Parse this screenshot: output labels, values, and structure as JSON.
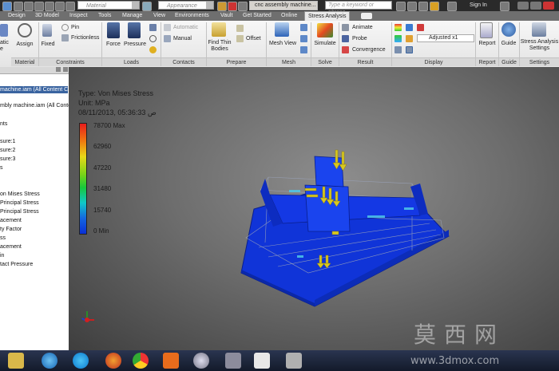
{
  "quick_access": {
    "material": "Material",
    "appearance": "Appearance",
    "doc_title": "cnc assembly machine...",
    "search_placeholder": "Type a keyword or phrase",
    "sign_in": "Sign In"
  },
  "tabs": [
    "Design",
    "3D Model",
    "Inspect",
    "Tools",
    "Manage",
    "View",
    "Environments",
    "Vault",
    "Get Started",
    "Online",
    "Stress Analysis"
  ],
  "ribbon": {
    "static_label_1": "atic",
    "static_label_2": "e",
    "assign": "Assign",
    "fixed": "Fixed",
    "pin": "Pin",
    "frictionless": "Frictionless",
    "force": "Force",
    "pressure": "Pressure",
    "automatic": "Automatic",
    "manual": "Manual",
    "find_thin_bodies_1": "Find Thin",
    "find_thin_bodies_2": "Bodies",
    "offset": "Offset",
    "mesh_view": "Mesh View",
    "simulate": "Simulate",
    "animate": "Animate",
    "probe": "Probe",
    "convergence": "Convergence",
    "adjusted": "Adjusted x1",
    "report": "Report",
    "guide": "Guide",
    "settings_1": "Stress Analysis",
    "settings_2": "Settings"
  },
  "panels": [
    "Material",
    "Constraints",
    "Loads",
    "Contacts",
    "Prepare",
    "Mesh",
    "Solve",
    "Result",
    "Display",
    "Report",
    "Guide",
    "Settings"
  ],
  "browser": {
    "selected": "machine.iam (All Content Center",
    "items": [
      "mbly machine.iam (All Content",
      "",
      "nts",
      "",
      "sure:1",
      "sure:2",
      "sure:3",
      "s",
      "",
      "",
      "on Mises Stress",
      "Principal Stress",
      "Principal Stress",
      "acement",
      "ty Factor",
      "ss",
      "acement",
      "in",
      "tact Pressure"
    ]
  },
  "viewport": {
    "type_line": "Type: Von Mises Stress",
    "unit_line": "Unit: MPa",
    "date_line": "08/11/2013, 05:36:33 ص",
    "legend": [
      {
        "label": "78700 Max",
        "fraction": 0
      },
      {
        "label": "62960",
        "fraction": 0.2
      },
      {
        "label": "47220",
        "fraction": 0.4
      },
      {
        "label": "31480",
        "fraction": 0.6
      },
      {
        "label": "15740",
        "fraction": 0.8
      },
      {
        "label": "0 Min",
        "fraction": 1
      }
    ]
  },
  "watermark": {
    "cn": "莫西网",
    "url": "www.3dmox.com"
  },
  "colors": {
    "model_blue": "#1034d8",
    "load_arrow": "#d8c820",
    "active_tab": "#e9e9e9"
  }
}
